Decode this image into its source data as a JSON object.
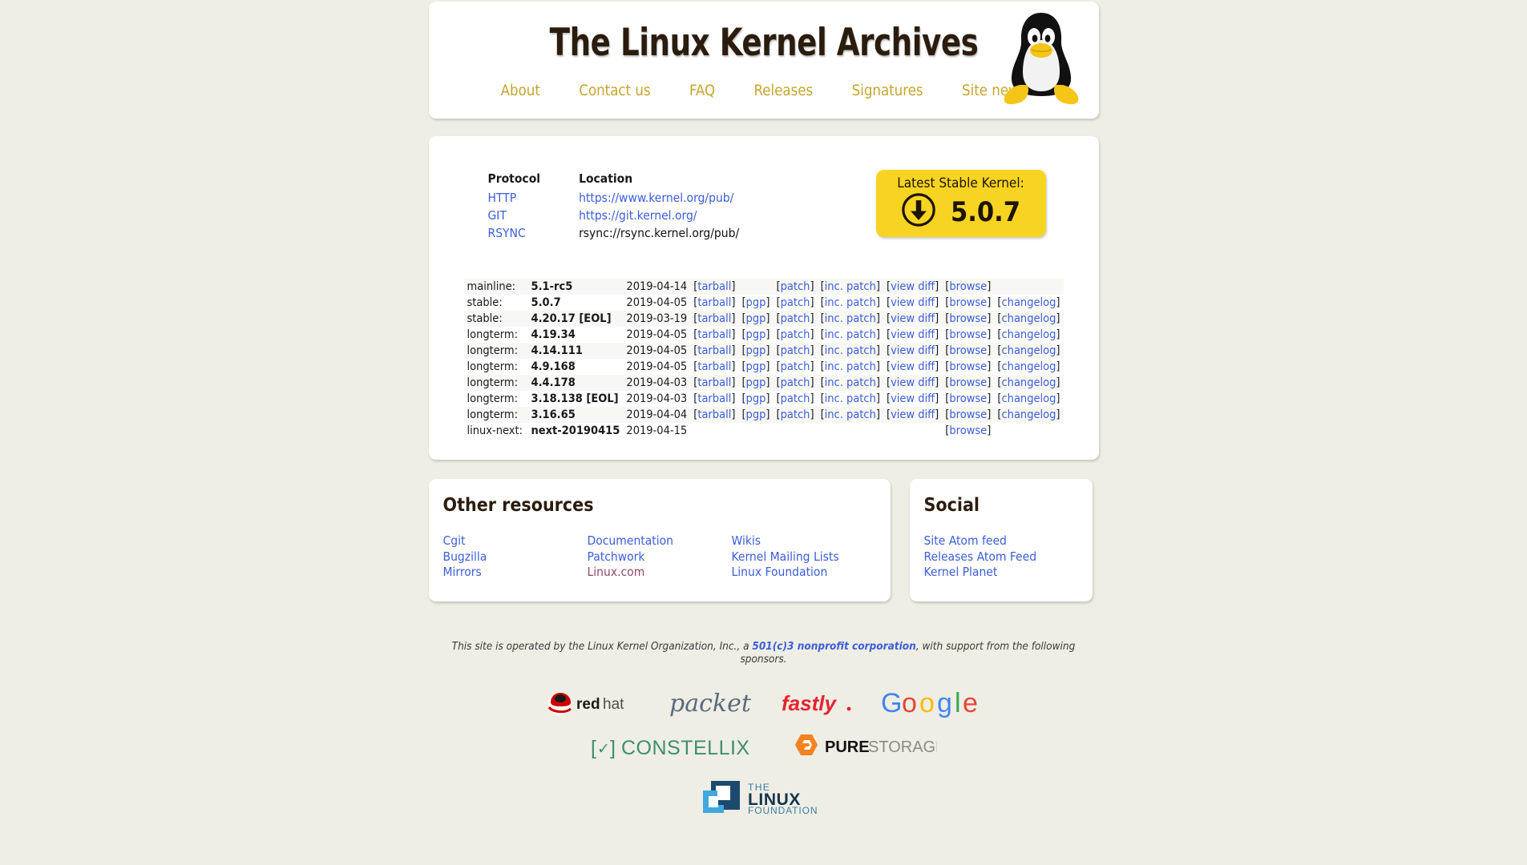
{
  "site": {
    "title": "The Linux Kernel Archives",
    "logo_icon": "tux-penguin-logo",
    "nav": [
      {
        "label": "About"
      },
      {
        "label": "Contact us"
      },
      {
        "label": "FAQ"
      },
      {
        "label": "Releases"
      },
      {
        "label": "Signatures"
      },
      {
        "label": "Site news"
      }
    ]
  },
  "protocols": {
    "headers": {
      "protocol": "Protocol",
      "location": "Location"
    },
    "rows": [
      {
        "protocol": "HTTP",
        "location": "https://www.kernel.org/pub/",
        "is_link": true
      },
      {
        "protocol": "GIT",
        "location": "https://git.kernel.org/",
        "is_link": true
      },
      {
        "protocol": "RSYNC",
        "location": "rsync://rsync.kernel.org/pub/",
        "is_link": false
      }
    ]
  },
  "latest_stable": {
    "label": "Latest Stable Kernel:",
    "version": "5.0.7",
    "icon": "download-circle-icon",
    "bg_color": "#f7d422"
  },
  "releases": {
    "link_labels": {
      "tarball": "tarball",
      "pgp": "pgp",
      "patch": "patch",
      "inc_patch": "inc. patch",
      "view_diff": "view diff",
      "browse": "browse",
      "changelog": "changelog"
    },
    "rows": [
      {
        "kind": "mainline:",
        "version": "5.1-rc5",
        "date": "2019-04-14",
        "tarball": true,
        "pgp": false,
        "patch": true,
        "inc_patch": true,
        "view_diff": true,
        "browse": true,
        "changelog": false
      },
      {
        "kind": "stable:",
        "version": "5.0.7",
        "date": "2019-04-05",
        "tarball": true,
        "pgp": true,
        "patch": true,
        "inc_patch": true,
        "view_diff": true,
        "browse": true,
        "changelog": true
      },
      {
        "kind": "stable:",
        "version": "4.20.17 [EOL]",
        "date": "2019-03-19",
        "tarball": true,
        "pgp": true,
        "patch": true,
        "inc_patch": true,
        "view_diff": true,
        "browse": true,
        "changelog": true
      },
      {
        "kind": "longterm:",
        "version": "4.19.34",
        "date": "2019-04-05",
        "tarball": true,
        "pgp": true,
        "patch": true,
        "inc_patch": true,
        "view_diff": true,
        "browse": true,
        "changelog": true
      },
      {
        "kind": "longterm:",
        "version": "4.14.111",
        "date": "2019-04-05",
        "tarball": true,
        "pgp": true,
        "patch": true,
        "inc_patch": true,
        "view_diff": true,
        "browse": true,
        "changelog": true
      },
      {
        "kind": "longterm:",
        "version": "4.9.168",
        "date": "2019-04-05",
        "tarball": true,
        "pgp": true,
        "patch": true,
        "inc_patch": true,
        "view_diff": true,
        "browse": true,
        "changelog": true
      },
      {
        "kind": "longterm:",
        "version": "4.4.178",
        "date": "2019-04-03",
        "tarball": true,
        "pgp": true,
        "patch": true,
        "inc_patch": true,
        "view_diff": true,
        "browse": true,
        "changelog": true
      },
      {
        "kind": "longterm:",
        "version": "3.18.138 [EOL]",
        "date": "2019-04-03",
        "tarball": true,
        "pgp": true,
        "patch": true,
        "inc_patch": true,
        "view_diff": true,
        "browse": true,
        "changelog": true
      },
      {
        "kind": "longterm:",
        "version": "3.16.65",
        "date": "2019-04-04",
        "tarball": true,
        "pgp": true,
        "patch": true,
        "inc_patch": true,
        "view_diff": true,
        "browse": true,
        "changelog": true
      },
      {
        "kind": "linux-next:",
        "version": "next-20190415",
        "date": "2019-04-15",
        "tarball": false,
        "pgp": false,
        "patch": false,
        "inc_patch": false,
        "view_diff": false,
        "browse": true,
        "changelog": false
      }
    ]
  },
  "other_resources": {
    "title": "Other resources",
    "columns": [
      [
        {
          "label": "Cgit",
          "visited": false
        },
        {
          "label": "Bugzilla",
          "visited": false
        },
        {
          "label": "Mirrors",
          "visited": false
        }
      ],
      [
        {
          "label": "Documentation",
          "visited": false
        },
        {
          "label": "Patchwork",
          "visited": false
        },
        {
          "label": "Linux.com",
          "visited": true
        }
      ],
      [
        {
          "label": "Wikis",
          "visited": false
        },
        {
          "label": "Kernel Mailing Lists",
          "visited": false
        },
        {
          "label": "Linux Foundation",
          "visited": false
        }
      ]
    ]
  },
  "social": {
    "title": "Social",
    "links": [
      {
        "label": "Site Atom feed"
      },
      {
        "label": "Releases Atom Feed"
      },
      {
        "label": "Kernel Planet"
      }
    ]
  },
  "footer": {
    "note_before": "This site is operated by the Linux Kernel Organization, Inc., a ",
    "note_link": "501(c)3 nonprofit corporation",
    "note_after": ", with support from the following sponsors.",
    "sponsors": [
      {
        "name": "redhat",
        "text_bold": "red",
        "text_light": "hat"
      },
      {
        "name": "packet",
        "text": "packet"
      },
      {
        "name": "fastly",
        "text": "fastly"
      },
      {
        "name": "google",
        "text": "Google"
      },
      {
        "name": "constellix",
        "text": "CONSTELLIX",
        "prefix": "[✓]"
      },
      {
        "name": "purestorage",
        "text_bold": "PURE",
        "text_light": "STORAGE"
      },
      {
        "name": "linux-foundation",
        "line1": "THE",
        "line2": "LINUX",
        "line3": "FOUNDATION"
      }
    ]
  }
}
